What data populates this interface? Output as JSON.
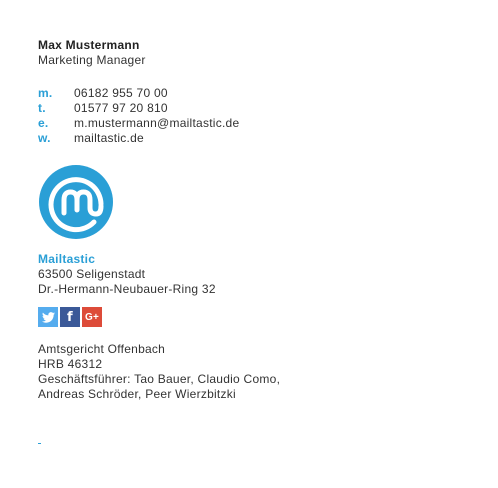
{
  "person": {
    "name": "Max Mustermann",
    "role": "Marketing Manager"
  },
  "contacts": [
    {
      "label": "m.",
      "value": "06182 955 70 00"
    },
    {
      "label": "t.",
      "value": "01577 97 20 810"
    },
    {
      "label": "e.",
      "value": "m.mustermann@mailtastic.de"
    },
    {
      "label": "w.",
      "value": "mailtastic.de"
    }
  ],
  "company": {
    "name": "Mailtastic",
    "address_line1": "63500 Seligenstadt",
    "address_line2": "Dr.-Hermann-Neubauer-Ring 32"
  },
  "social": [
    {
      "icon": "twitter-icon",
      "glyph": "🐦",
      "color": "#55acee"
    },
    {
      "icon": "facebook-icon",
      "glyph": "f",
      "color": "#3b5998"
    },
    {
      "icon": "google-plus-icon",
      "glyph": "G+",
      "color": "#dd4b39"
    }
  ],
  "legal": [
    "Amtsgericht Offenbach",
    "HRB 46312",
    "Geschäftsführer: Tao Bauer, Claudio Como,",
    "Andreas Schröder, Peer Wierzbitzki"
  ],
  "colors": {
    "accent": "#2a9fd6",
    "text": "#333333"
  }
}
